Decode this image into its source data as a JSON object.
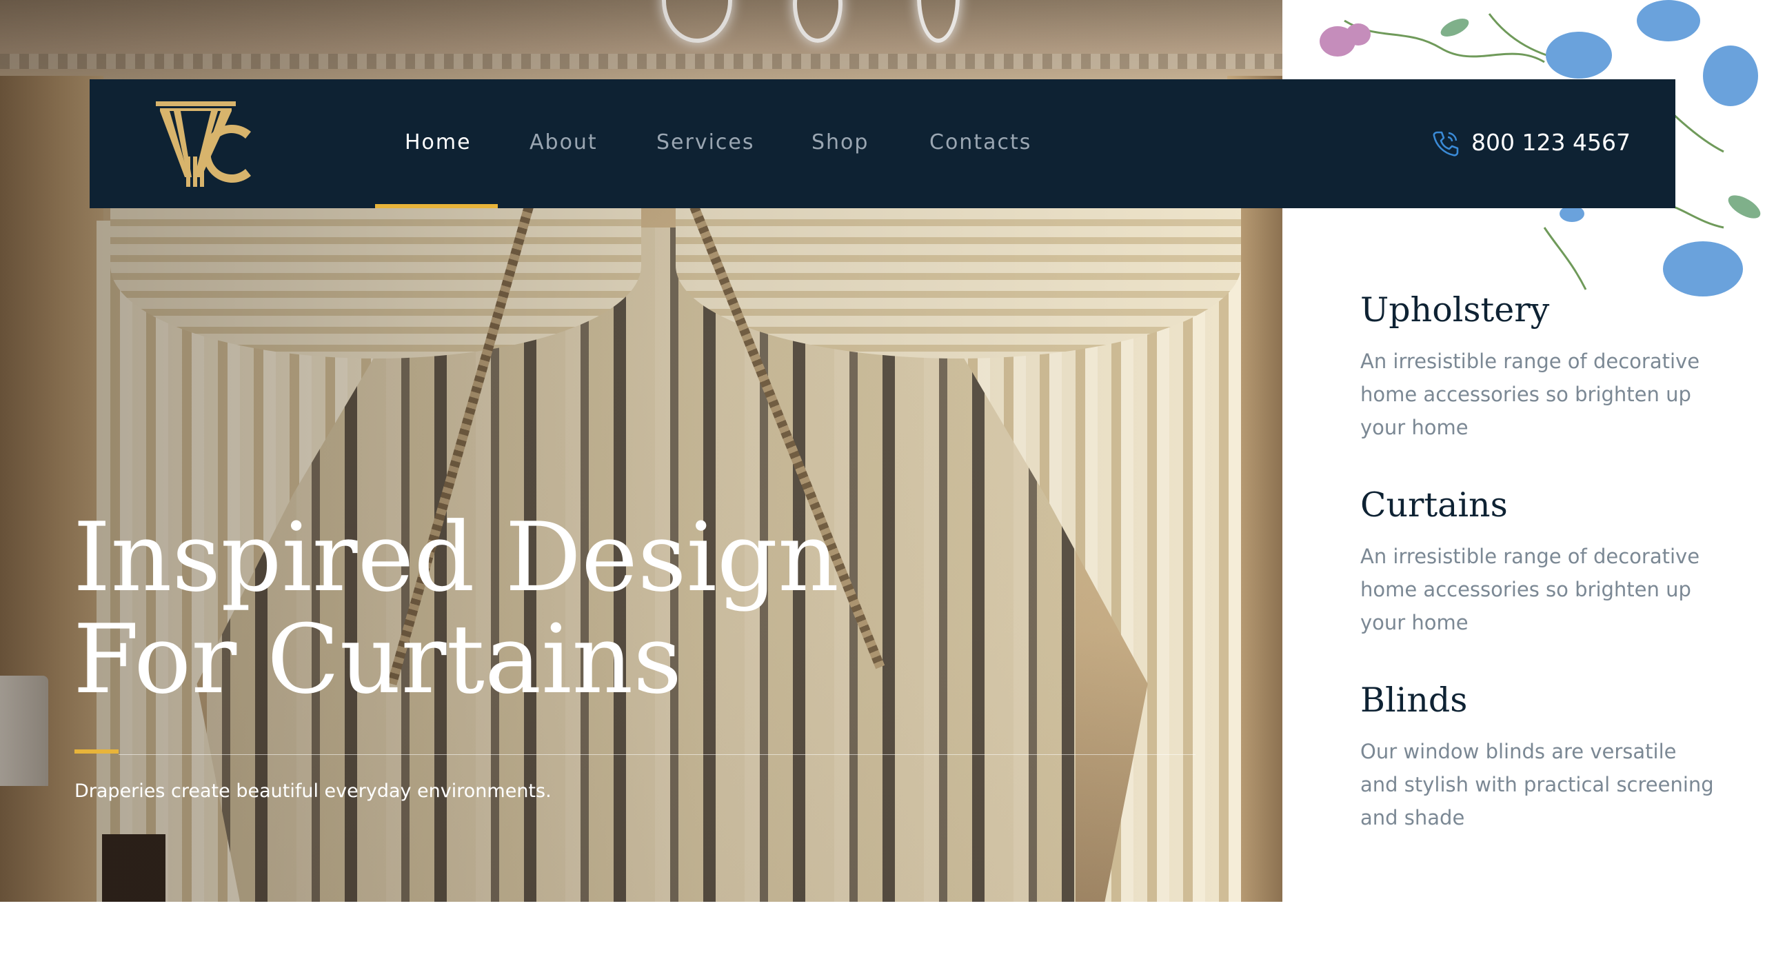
{
  "nav": {
    "items": [
      {
        "label": "Home",
        "active": true
      },
      {
        "label": "About",
        "active": false
      },
      {
        "label": "Services",
        "active": false
      },
      {
        "label": "Shop",
        "active": false
      },
      {
        "label": "Contacts",
        "active": false
      }
    ],
    "phone": "800 123 4567"
  },
  "hero": {
    "title_line1": "Inspired Design",
    "title_line2": "For Curtains",
    "subtitle": "Draperies create beautiful everyday environments."
  },
  "services": [
    {
      "title": "Upholstery",
      "description": "An irresistible range of decorative home accessories so brighten up your home"
    },
    {
      "title": "Curtains",
      "description": "An irresistible range of decorative home accessories so brighten up your home"
    },
    {
      "title": "Blinds",
      "description": "Our window blinds are versatile and stylish with practical screening and shade"
    }
  ],
  "colors": {
    "navy": "#0e2233",
    "gold": "#e8b43a",
    "logo_gold": "#d8b46c",
    "muted_text": "#7b8894",
    "phone_icon": "#3a8ad6"
  },
  "icons": {
    "logo": "curtain-logo-icon",
    "phone": "phone-icon",
    "decoration": "floral-decoration"
  }
}
